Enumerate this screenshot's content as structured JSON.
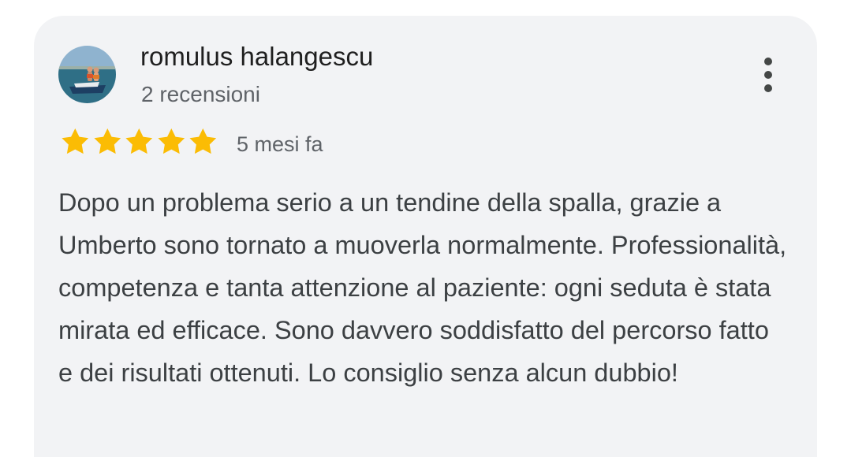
{
  "review": {
    "author_name": "romulus halangescu",
    "review_count": "2 recensioni",
    "rating": 5,
    "rating_max": 5,
    "date": "5 mesi fa",
    "text": "Dopo un problema serio a un tendine della spalla, grazie a Umberto sono tornato a muoverla normalmente. Professionalità, competenza e tanta attenzione al paziente: ogni seduta è stata mirata ed efficace. Sono davvero soddisfatto del percorso fatto e dei risultati ottenuti. Lo consiglio senza alcun dubbio!"
  },
  "icons": {
    "more": "more-vert-icon",
    "star": "star-icon"
  },
  "colors": {
    "card_background": "#f2f3f5",
    "star": "#fbbc04",
    "name_text": "#1f1f1f",
    "secondary_text": "#5f6368",
    "body_text": "#3c4043"
  }
}
